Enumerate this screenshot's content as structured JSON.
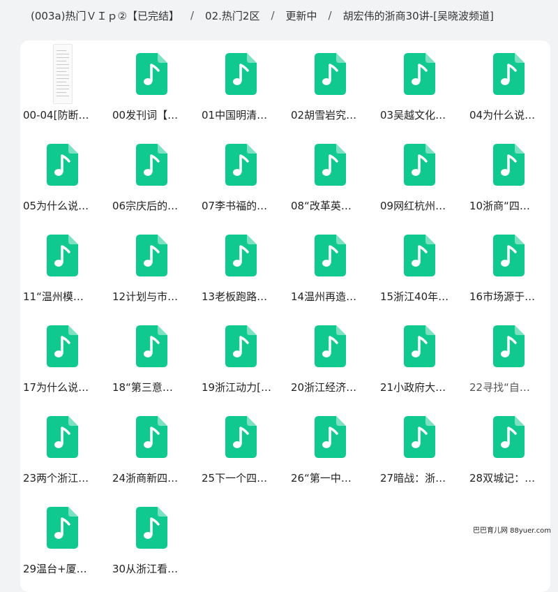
{
  "breadcrumb": [
    {
      "label": "(003a)热门ＶＩｐ②【已完结】"
    },
    {
      "label": "02.热门2区"
    },
    {
      "label": "更新中"
    },
    {
      "label": "胡宏伟的浙商30讲-[吴晓波频道]"
    }
  ],
  "breadcrumb_separator": "/",
  "files": [
    {
      "name": "00-04[防断…",
      "type": "document"
    },
    {
      "name": "00发刊词【…",
      "type": "audio"
    },
    {
      "name": "01中国明清…",
      "type": "audio"
    },
    {
      "name": "02胡雪岩究…",
      "type": "audio"
    },
    {
      "name": "03吴越文化…",
      "type": "audio"
    },
    {
      "name": "04为什么说…",
      "type": "audio"
    },
    {
      "name": "05为什么说…",
      "type": "audio"
    },
    {
      "name": "06宗庆后的…",
      "type": "audio"
    },
    {
      "name": "07李书福的…",
      "type": "audio"
    },
    {
      "name": "08“改革英…",
      "type": "audio"
    },
    {
      "name": "09网红杭州…",
      "type": "audio"
    },
    {
      "name": "10浙商“四…",
      "type": "audio"
    },
    {
      "name": "11“温州模…",
      "type": "audio"
    },
    {
      "name": "12计划与市…",
      "type": "audio"
    },
    {
      "name": "13老板跑路…",
      "type": "audio"
    },
    {
      "name": "14温州再造…",
      "type": "audio"
    },
    {
      "name": "15浙江40年…",
      "type": "audio"
    },
    {
      "name": "16市场源于…",
      "type": "audio"
    },
    {
      "name": "17为什么说…",
      "type": "audio"
    },
    {
      "name": "18“第三意…",
      "type": "audio"
    },
    {
      "name": "19浙江动力[…",
      "type": "audio"
    },
    {
      "name": "20浙江经济…",
      "type": "audio"
    },
    {
      "name": "21小政府大…",
      "type": "audio"
    },
    {
      "name": "22寻找“自…",
      "type": "audio"
    },
    {
      "name": "23两个浙江…",
      "type": "audio"
    },
    {
      "name": "24浙商新四…",
      "type": "audio"
    },
    {
      "name": "25下一个四…",
      "type": "audio"
    },
    {
      "name": "26“第一中…",
      "type": "audio"
    },
    {
      "name": "27暗战：浙…",
      "type": "audio"
    },
    {
      "name": "28双城记：…",
      "type": "audio"
    },
    {
      "name": "29温台+厦…",
      "type": "audio"
    },
    {
      "name": "30从浙江看…",
      "type": "audio"
    }
  ],
  "watermark": "巴巴育儿网 88yuer.com",
  "colors": {
    "accent": "#10c98f",
    "background": "#f2f3f5",
    "panel": "#ffffff"
  },
  "icons": {
    "audio": "music-file-icon",
    "document": "document-thumbnail-icon"
  }
}
